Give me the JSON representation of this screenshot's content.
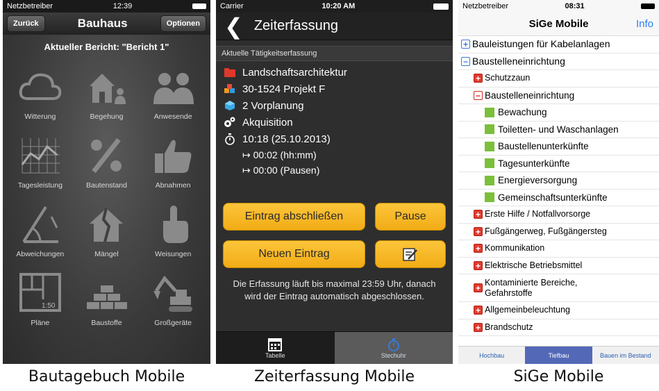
{
  "bautagebuch": {
    "status": {
      "carrier": "Netzbetreiber",
      "time": "12:39"
    },
    "nav": {
      "back": "Zurück",
      "title": "Bauhaus",
      "options": "Optionen"
    },
    "report": "Aktueller Bericht: \"Bericht 1\"",
    "tiles": [
      {
        "label": "Witterung",
        "icon": "cloud-icon"
      },
      {
        "label": "Begehung",
        "icon": "house-person-icon"
      },
      {
        "label": "Anwesende",
        "icon": "people-icon"
      },
      {
        "label": "Tagesleistung",
        "icon": "chart-icon"
      },
      {
        "label": "Bautenstand",
        "icon": "percent-icon"
      },
      {
        "label": "Abnahmen",
        "icon": "thumbs-up-icon"
      },
      {
        "label": "Abweichungen",
        "icon": "protractor-icon"
      },
      {
        "label": "Mängel",
        "icon": "broken-house-icon"
      },
      {
        "label": "Weisungen",
        "icon": "pointing-hand-icon"
      },
      {
        "label": "Pläne",
        "icon": "floorplan-icon",
        "scale": "1:50"
      },
      {
        "label": "Baustoffe",
        "icon": "bricks-icon"
      },
      {
        "label": "Großgeräte",
        "icon": "excavator-icon"
      }
    ],
    "caption": "Bautagebuch Mobile"
  },
  "zeiterfassung": {
    "status": {
      "carrier": "Carrier",
      "time": "10:20 AM"
    },
    "nav": {
      "title": "Zeiterfassung"
    },
    "section": "Aktuelle Tätigkeitserfassung",
    "rows": [
      {
        "text": "Landschaftsarchitektur",
        "icon": "folder-icon"
      },
      {
        "text": "30-1524 Projekt F",
        "icon": "cubes-icon"
      },
      {
        "text": "2 Vorplanung",
        "icon": "cube-icon"
      },
      {
        "text": "Akquisition",
        "icon": "gears-icon"
      },
      {
        "text": "10:18 (25.10.2013)",
        "icon": "stopwatch-icon"
      }
    ],
    "durations": [
      "↦ 00:02 (hh:mm)",
      "↦ 00:00 (Pausen)"
    ],
    "buttons": {
      "finish": "Eintrag abschließen",
      "pause": "Pause",
      "new": "Neuen Eintrag"
    },
    "note": "Die Erfassung läuft bis maximal 23:59 Uhr, danach wird der Eintrag automatisch abgeschlossen.",
    "tabs": {
      "table": "Tabelle",
      "stopwatch": "Stechuhr"
    },
    "caption": "Zeiterfassung Mobile"
  },
  "sige": {
    "status": {
      "carrier": "Netzbetreiber",
      "time": "08:31"
    },
    "nav": {
      "title": "SiGe Mobile",
      "info": "Info"
    },
    "tree": [
      {
        "label": "Bauleistungen für Kabelanlagen",
        "type": "blue-plus",
        "level": 0
      },
      {
        "label": "Baustelleneinrichtung",
        "type": "blue-minus",
        "level": 0
      },
      {
        "label": "Schutzzaun",
        "type": "red-plus",
        "level": 1
      },
      {
        "label": "Baustelleneinrichtung",
        "type": "red-minus",
        "level": 1
      },
      {
        "label": "Bewachung",
        "type": "leaf",
        "level": 2
      },
      {
        "label": "Toiletten- und Waschanlagen",
        "type": "leaf",
        "level": 2
      },
      {
        "label": "Baustellenunterkünfte",
        "type": "leaf",
        "level": 2
      },
      {
        "label": "Tagesunterkünfte",
        "type": "leaf",
        "level": 2
      },
      {
        "label": "Energieversorgung",
        "type": "leaf",
        "level": 2
      },
      {
        "label": "Gemeinschaftsunterkünfte",
        "type": "leaf",
        "level": 2
      },
      {
        "label": "Erste Hilfe / Notfallvorsorge",
        "type": "red-plus",
        "level": 1
      },
      {
        "label": "Fußgängerweg, Fußgängersteg",
        "type": "red-plus",
        "level": 1
      },
      {
        "label": "Kommunikation",
        "type": "red-plus",
        "level": 1
      },
      {
        "label": "Elektrische Betriebsmittel",
        "type": "red-plus",
        "level": 1
      },
      {
        "label": "Kontaminierte Bereiche, Gefahrstoffe",
        "type": "red-plus",
        "level": 1,
        "tall": true
      },
      {
        "label": "Allgemeinbeleuchtung",
        "type": "red-plus",
        "level": 1
      },
      {
        "label": "Brandschutz",
        "type": "red-plus",
        "level": 1
      }
    ],
    "tabs": [
      "Hochbau",
      "Tiefbau",
      "Bauen im Bestand"
    ],
    "caption": "SiGe Mobile"
  }
}
